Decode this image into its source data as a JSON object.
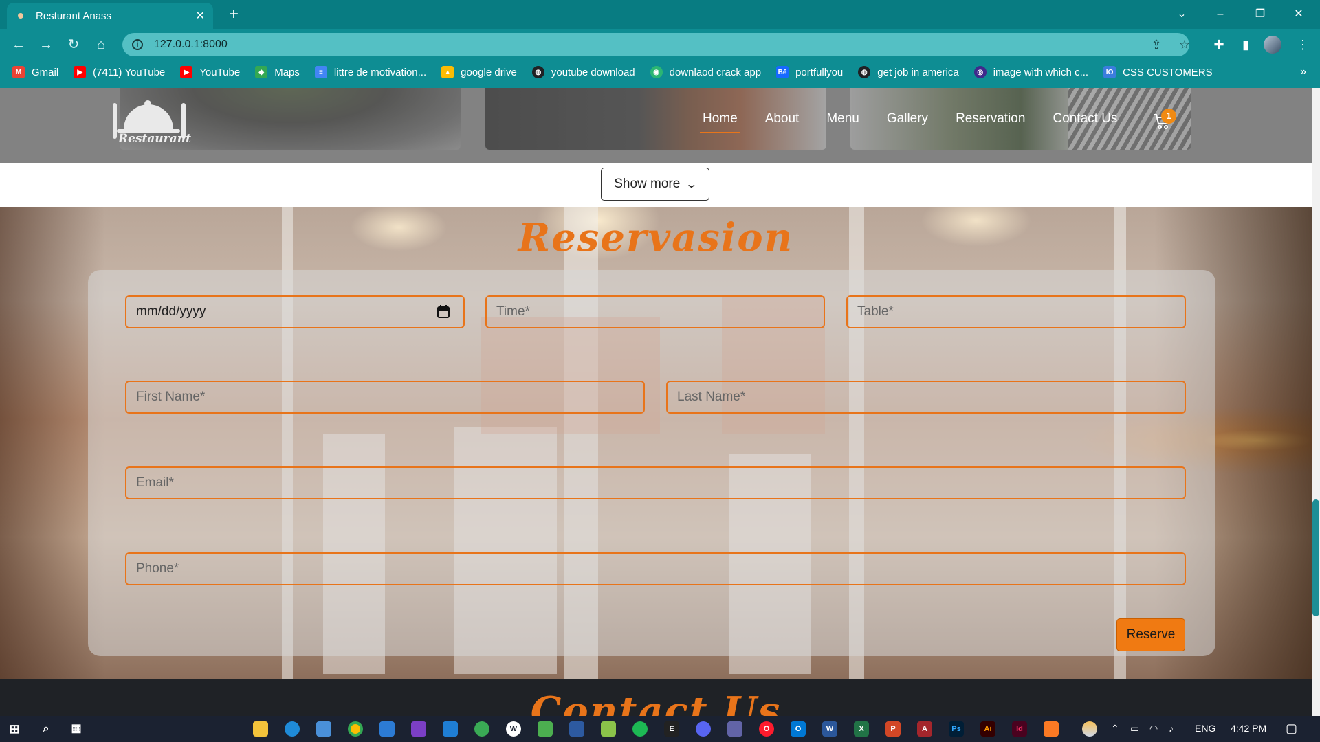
{
  "browser": {
    "tab_title": "Resturant Anass",
    "url": "127.0.0.1:8000",
    "bookmarks": [
      {
        "label": "Gmail",
        "icon": "gmail-icon",
        "color": "#ea4335"
      },
      {
        "label": "(7411) YouTube",
        "icon": "youtube-icon",
        "color": "#ff0000"
      },
      {
        "label": "YouTube",
        "icon": "youtube-icon",
        "color": "#ff0000"
      },
      {
        "label": "Maps",
        "icon": "maps-icon",
        "color": "#34a853"
      },
      {
        "label": "littre de motivation...",
        "icon": "docs-icon",
        "color": "#4285f4"
      },
      {
        "label": "google drive",
        "icon": "drive-icon",
        "color": "#fbbc04"
      },
      {
        "label": "youtube download",
        "icon": "globe-icon",
        "color": "#202124"
      },
      {
        "label": "downlaod crack app",
        "icon": "crack-icon",
        "color": "#2bb673"
      },
      {
        "label": "portfullyou",
        "icon": "behance-icon",
        "color": "#1769ff"
      },
      {
        "label": "get job in america",
        "icon": "globe-icon",
        "color": "#202124"
      },
      {
        "label": "image with which c...",
        "icon": "image-icon",
        "color": "#3f2a8c"
      },
      {
        "label": "CSS CUSTOMERS",
        "icon": "css-icon",
        "color": "#3b7ddd"
      }
    ]
  },
  "site": {
    "logo_text": "Restaurant",
    "nav": [
      "Home",
      "About",
      "Menu",
      "Gallery",
      "Reservation",
      "Contact Us"
    ],
    "cart_count": "1",
    "show_more_label": "Show more"
  },
  "reservation": {
    "title": "Reservasion",
    "date_value": "mm/dd/yyyy",
    "time_placeholder": "Time*",
    "table_placeholder": "Table*",
    "first_name_placeholder": "First Name*",
    "last_name_placeholder": "Last Name*",
    "email_placeholder": "Email*",
    "phone_placeholder": "Phone*",
    "reserve_label": "Reserve"
  },
  "contact": {
    "title": "Contact Us"
  },
  "taskbar": {
    "language": "ENG",
    "time": "4:42 PM"
  },
  "colors": {
    "accent": "#e8741a",
    "browser_teal": "#0e8d93",
    "reserve_button": "#f07a12"
  }
}
